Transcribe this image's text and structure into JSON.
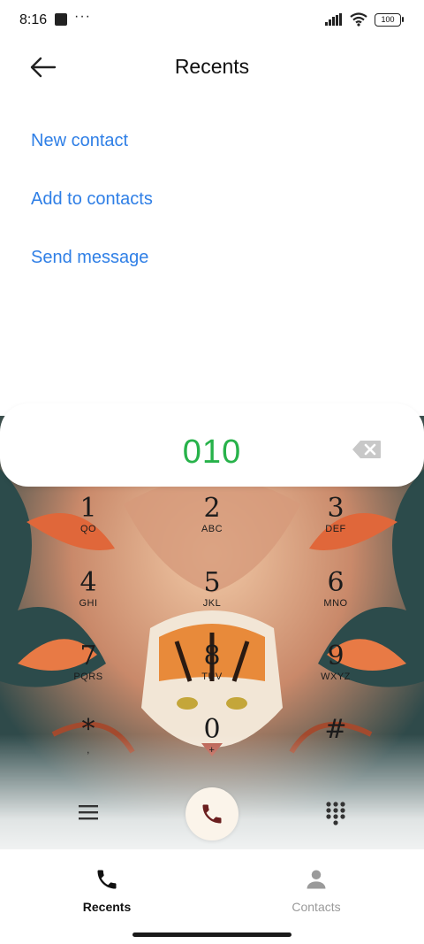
{
  "status_bar": {
    "time": "8:16",
    "dots": "···",
    "battery": "100"
  },
  "header": {
    "title": "Recents"
  },
  "actions": [
    {
      "label": "New contact"
    },
    {
      "label": "Add to contacts"
    },
    {
      "label": "Send message"
    }
  ],
  "dialer": {
    "number": "010"
  },
  "keypad": [
    {
      "digit": "1",
      "letters": "QO"
    },
    {
      "digit": "2",
      "letters": "ABC"
    },
    {
      "digit": "3",
      "letters": "DEF"
    },
    {
      "digit": "4",
      "letters": "GHI"
    },
    {
      "digit": "5",
      "letters": "JKL"
    },
    {
      "digit": "6",
      "letters": "MNO"
    },
    {
      "digit": "7",
      "letters": "PQRS"
    },
    {
      "digit": "8",
      "letters": "TUV"
    },
    {
      "digit": "9",
      "letters": "WXYZ"
    },
    {
      "digit": "*",
      "letters": ","
    },
    {
      "digit": "0",
      "letters": "+"
    },
    {
      "digit": "#",
      "letters": ""
    }
  ],
  "tabs": [
    {
      "label": "Recents",
      "active": true,
      "icon": "phone-icon"
    },
    {
      "label": "Contacts",
      "active": false,
      "icon": "person-icon"
    }
  ],
  "colors": {
    "accent": "#2f7fe6",
    "number": "#27b24a",
    "inactive_tab": "#9a9a9a"
  }
}
